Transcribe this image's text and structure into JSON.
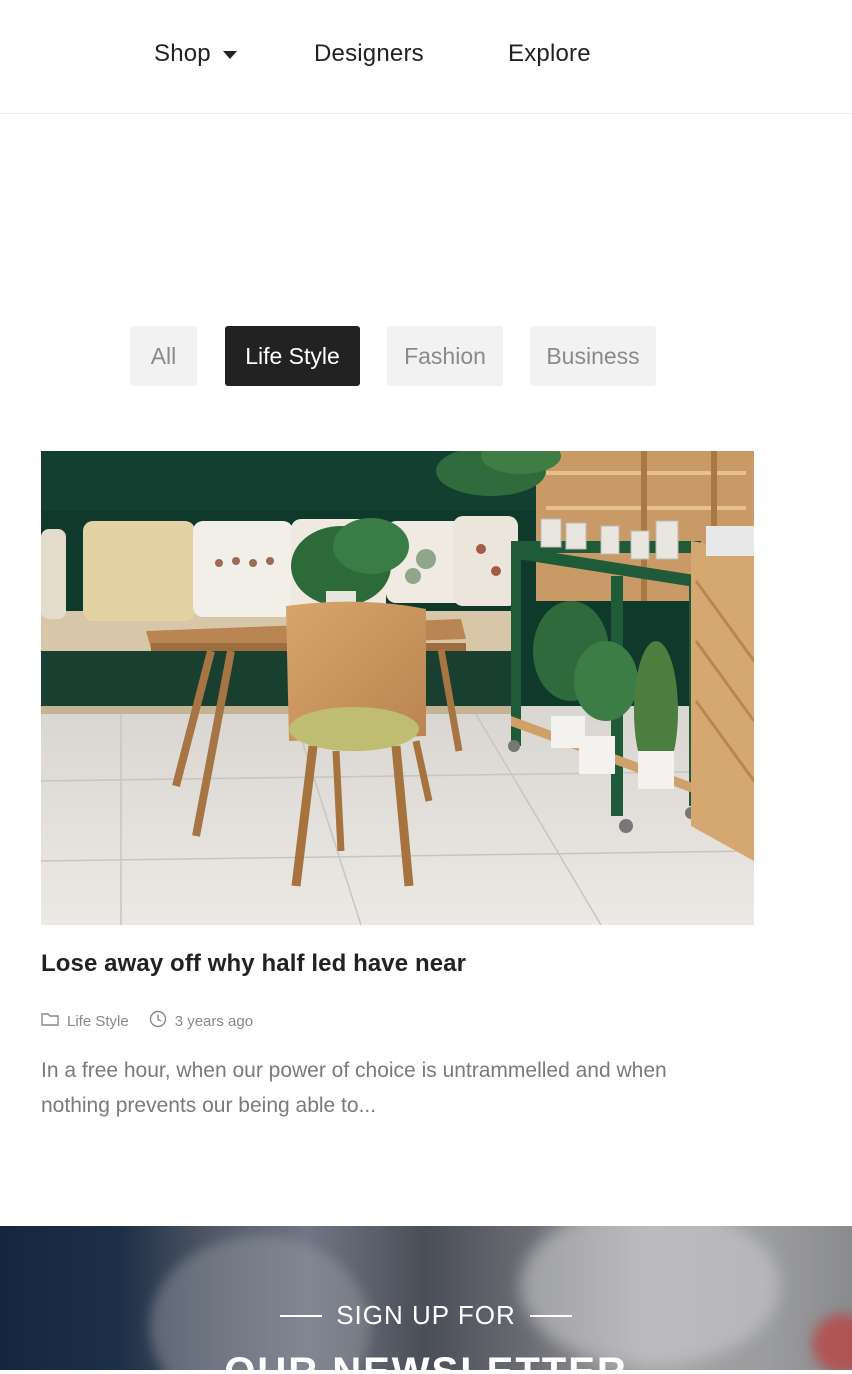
{
  "nav": {
    "items": [
      {
        "label": "Shop",
        "has_dropdown": true
      },
      {
        "label": "Designers"
      },
      {
        "label": "Explore"
      }
    ]
  },
  "filters": {
    "tabs": [
      {
        "label": "All",
        "active": false
      },
      {
        "label": "Life Style",
        "active": true
      },
      {
        "label": "Fashion",
        "active": false
      },
      {
        "label": "Business",
        "active": false
      }
    ]
  },
  "post": {
    "title": "Lose away off why half led have near",
    "category": "Life Style",
    "time": "3 years ago",
    "excerpt": "In a free hour, when our power of choice is untrammelled and when nothing prevents our being able to..."
  },
  "newsletter": {
    "subtitle": "SIGN UP FOR",
    "title": "OUR NEWSLETTER"
  }
}
